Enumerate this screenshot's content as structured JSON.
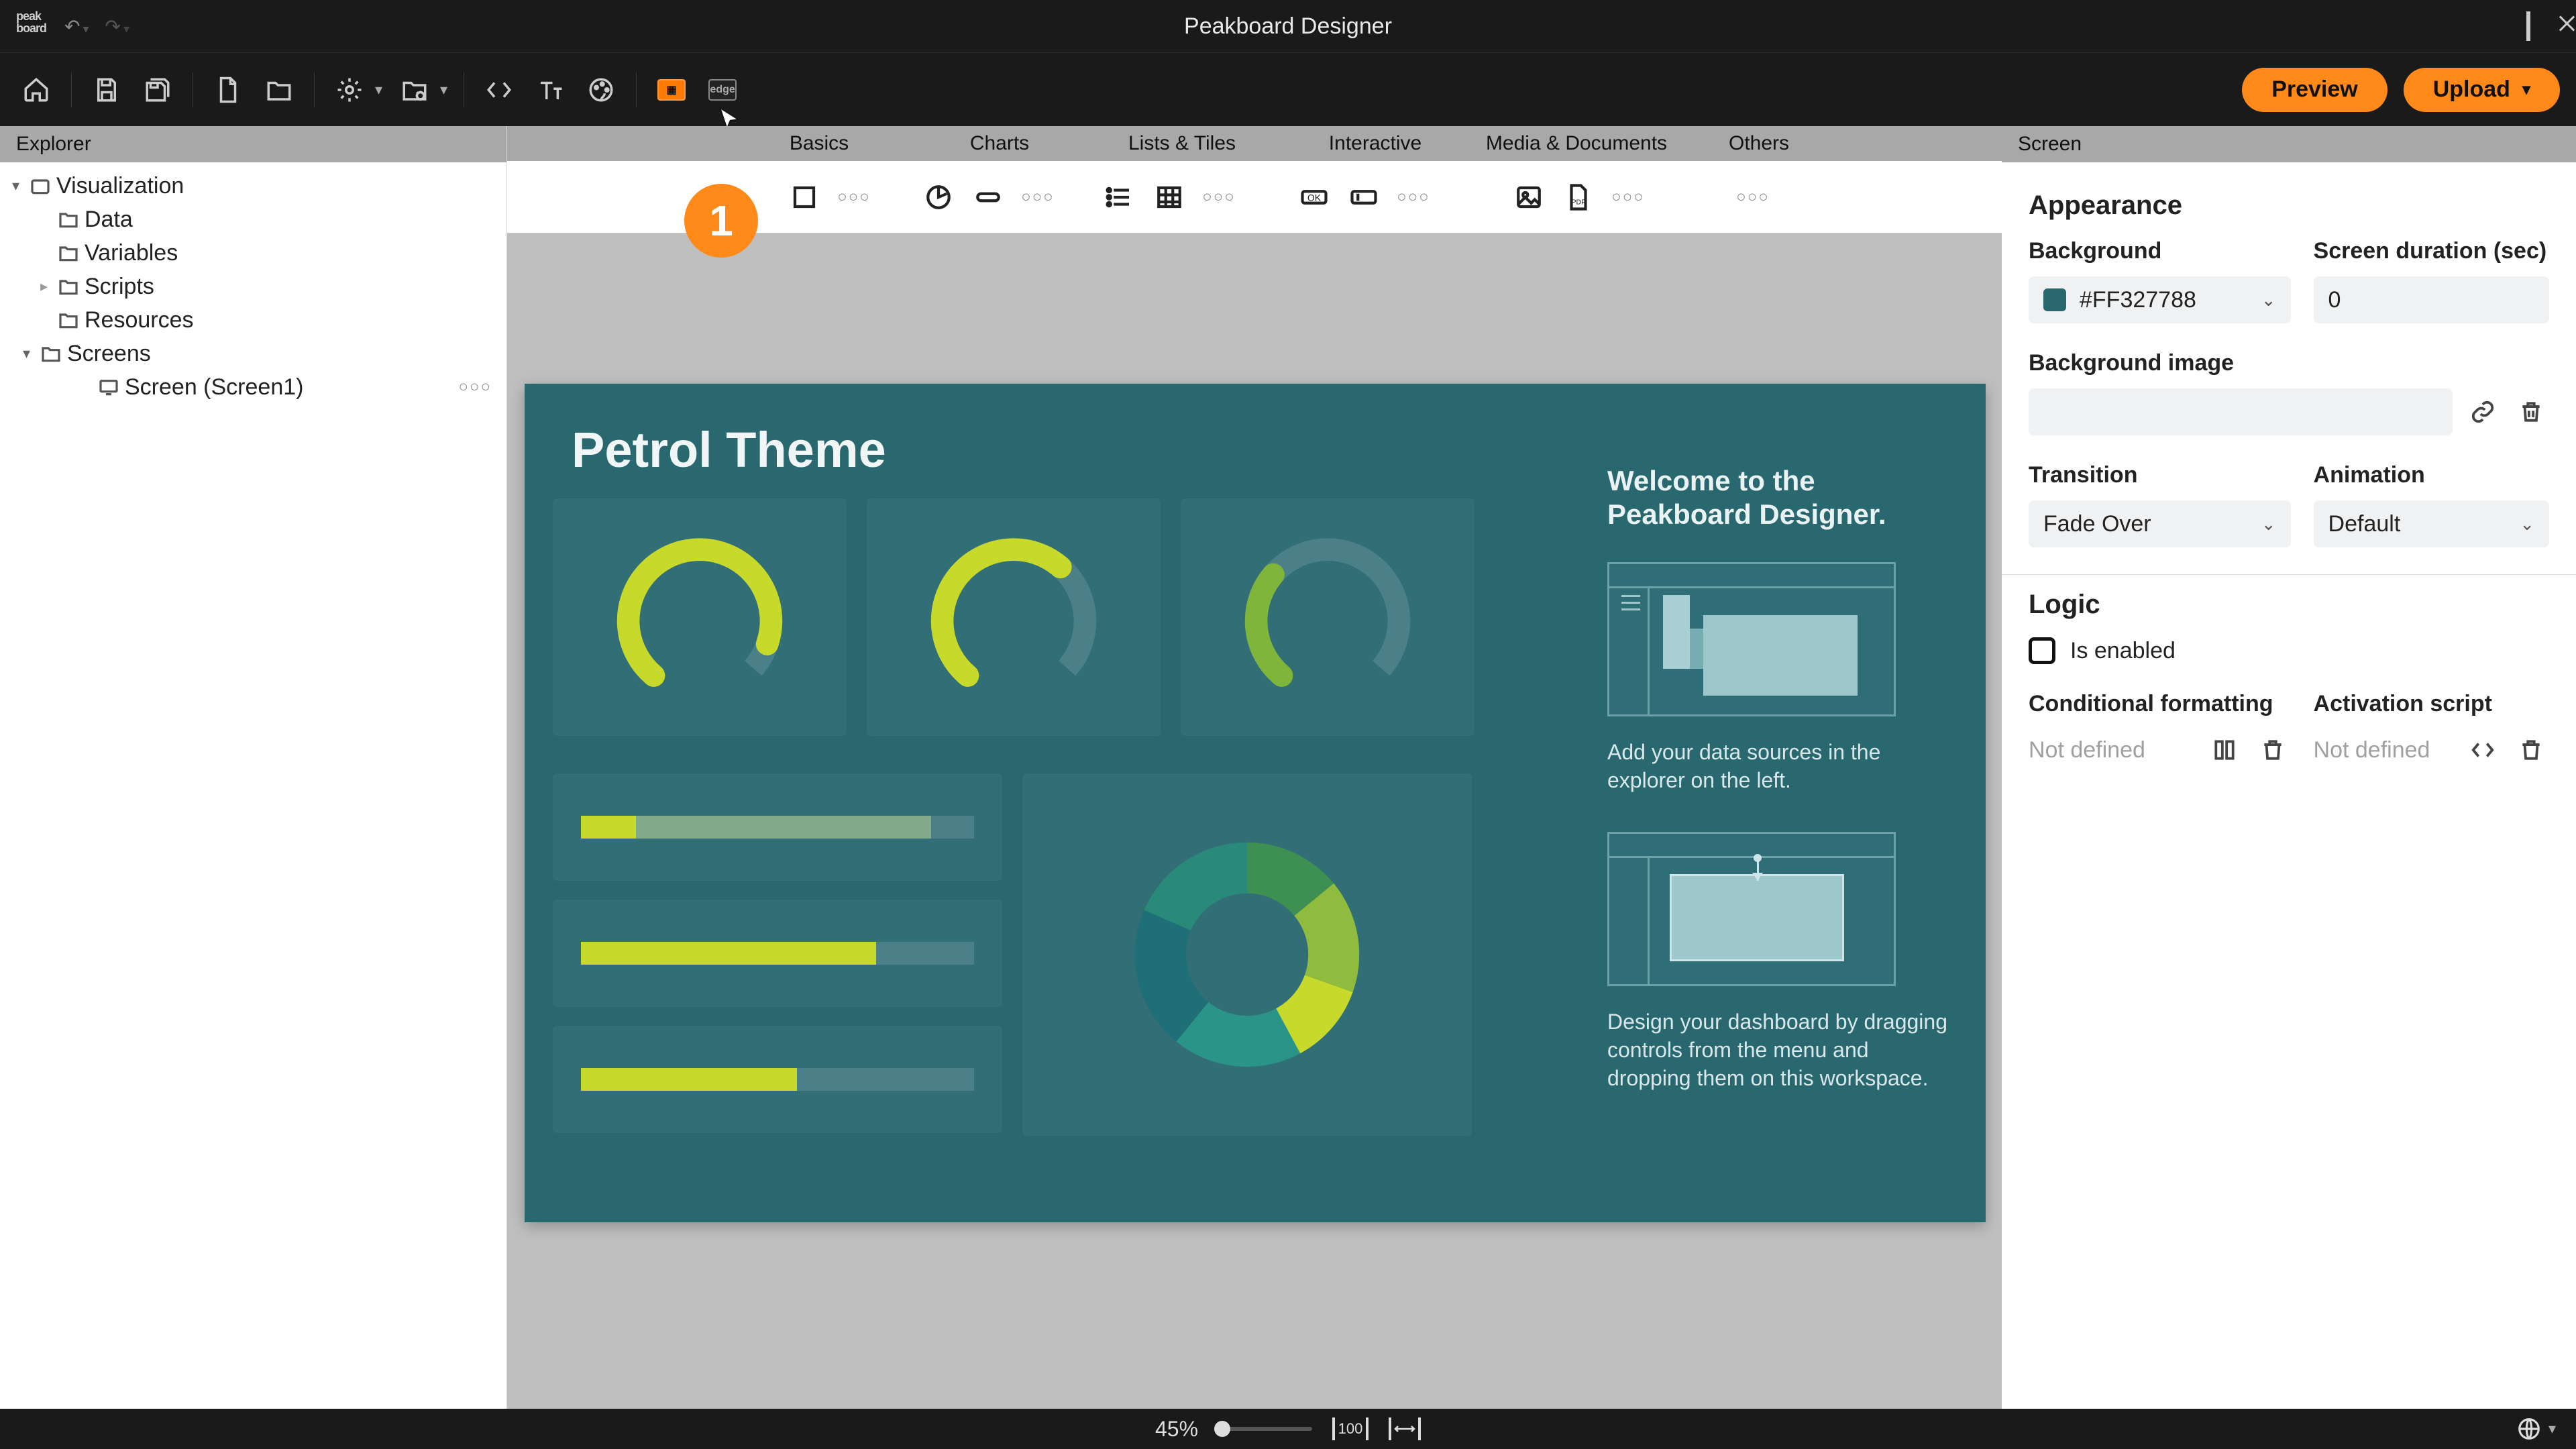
{
  "app": {
    "title": "Peakboard Designer"
  },
  "step_badge": "1",
  "toolbar": {
    "preview": "Preview",
    "upload": "Upload"
  },
  "explorer": {
    "header": "Explorer",
    "root": "Visualization",
    "items": [
      "Data",
      "Variables",
      "Scripts",
      "Resources",
      "Screens"
    ],
    "screen_item": "Screen (Screen1)"
  },
  "ribbon": {
    "groups": [
      "Basics",
      "Charts",
      "Lists & Tiles",
      "Interactive",
      "Media & Documents",
      "Others"
    ]
  },
  "canvas": {
    "title": "Petrol Theme",
    "welcome_title_l1": "Welcome to the",
    "welcome_title_l2": "Peakboard Designer.",
    "welcome_p1": "Add your data sources in the explorer on the left.",
    "welcome_p2": "Design your dashboard by dragging controls from the menu and dropping them on this workspace.",
    "bars": [
      {
        "fill": 14,
        "partial": 75
      },
      {
        "fill": 75,
        "partial": 0
      },
      {
        "fill": 55,
        "partial": 0
      }
    ]
  },
  "props": {
    "header": "Screen",
    "section_appearance": "Appearance",
    "background_lbl": "Background",
    "background_val": "#FF327788",
    "duration_lbl": "Screen duration (sec)",
    "duration_val": "0",
    "bgimg_lbl": "Background image",
    "transition_lbl": "Transition",
    "transition_val": "Fade Over",
    "animation_lbl": "Animation",
    "animation_val": "Default",
    "section_logic": "Logic",
    "is_enabled": "Is enabled",
    "cond_lbl": "Conditional formatting",
    "activation_lbl": "Activation script",
    "not_defined": "Not defined"
  },
  "status": {
    "zoom": "45%"
  }
}
